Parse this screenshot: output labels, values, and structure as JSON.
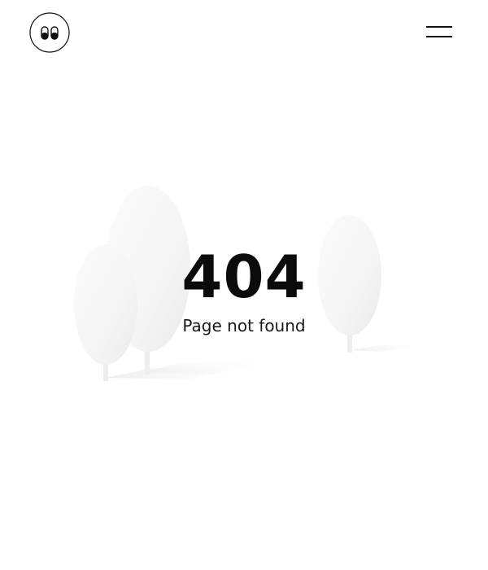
{
  "header": {
    "logo_icon": "eyes-logo-icon",
    "menu_icon": "hamburger-menu-icon"
  },
  "error": {
    "code": "404",
    "message": "Page not found"
  },
  "illustration": {
    "description_icon": "trees-illustration"
  },
  "colors": {
    "background": "#ffffff",
    "text": "#0b0b0b",
    "tree_fill": "#f4f4f4",
    "tree_shadow": "#eeeeee"
  }
}
